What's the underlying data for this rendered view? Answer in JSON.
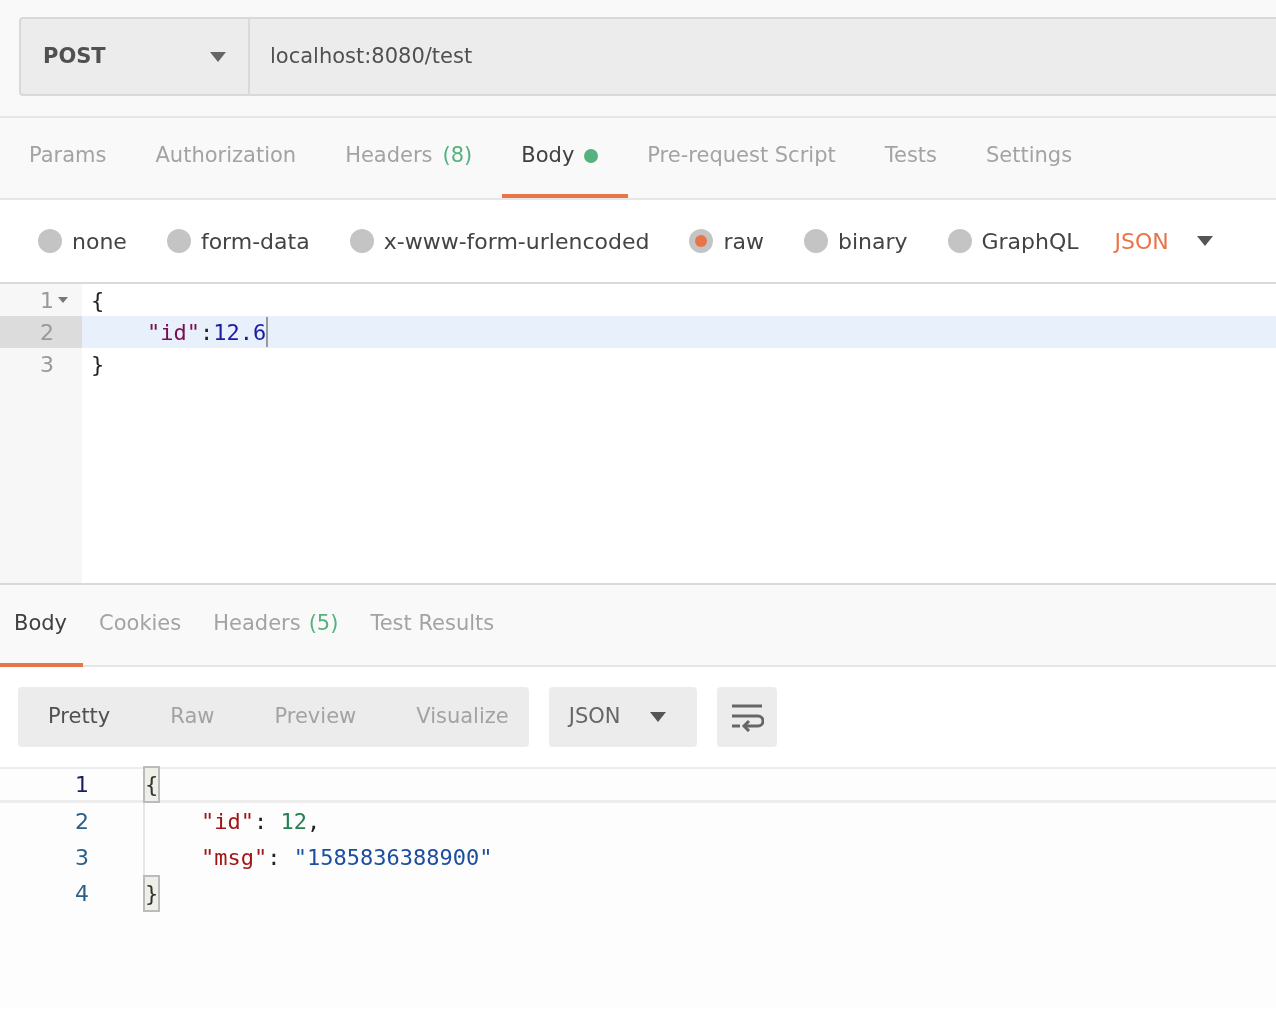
{
  "request": {
    "method": "POST",
    "url": "localhost:8080/test"
  },
  "request_tabs": [
    {
      "label": "Params",
      "selected": false
    },
    {
      "label": "Authorization",
      "selected": false
    },
    {
      "label": "Headers",
      "count": "(8)",
      "selected": false
    },
    {
      "label": "Body",
      "selected": true,
      "has_changes": true
    },
    {
      "label": "Pre-request Script",
      "selected": false
    },
    {
      "label": "Tests",
      "selected": false
    },
    {
      "label": "Settings",
      "selected": false
    }
  ],
  "body_types": [
    {
      "label": "none",
      "selected": false
    },
    {
      "label": "form-data",
      "selected": false
    },
    {
      "label": "x-www-form-urlencoded",
      "selected": false
    },
    {
      "label": "raw",
      "selected": true
    },
    {
      "label": "binary",
      "selected": false
    },
    {
      "label": "GraphQL",
      "selected": false
    }
  ],
  "body_format": "JSON",
  "request_editor": {
    "lines": [
      {
        "number": "1",
        "foldable": true,
        "selected": false,
        "tokens": [
          {
            "kind": "punct",
            "text": "{"
          }
        ]
      },
      {
        "number": "2",
        "foldable": false,
        "selected": true,
        "tokens": [
          {
            "kind": "key",
            "text": "\"id\""
          },
          {
            "kind": "punct",
            "text": ":"
          },
          {
            "kind": "number",
            "text": "12.6"
          }
        ]
      },
      {
        "number": "3",
        "foldable": false,
        "selected": false,
        "tokens": [
          {
            "kind": "punct",
            "text": "}"
          }
        ]
      }
    ]
  },
  "response_tabs": [
    {
      "label": "Body",
      "selected": true
    },
    {
      "label": "Cookies",
      "selected": false
    },
    {
      "label": "Headers",
      "count": "(5)",
      "selected": false
    },
    {
      "label": "Test Results",
      "selected": false
    }
  ],
  "view_modes": [
    {
      "label": "Pretty",
      "selected": true
    },
    {
      "label": "Raw",
      "selected": false
    },
    {
      "label": "Preview",
      "selected": false
    },
    {
      "label": "Visualize",
      "selected": false
    }
  ],
  "response_format": "JSON",
  "response_editor": {
    "lines": [
      {
        "number": "1",
        "tokens": [
          {
            "kind": "bracket-matched",
            "text": "{"
          }
        ]
      },
      {
        "number": "2",
        "tokens": [
          {
            "kind": "key",
            "text": "\"id\""
          },
          {
            "kind": "punct",
            "text": ": "
          },
          {
            "kind": "number",
            "text": "12"
          },
          {
            "kind": "punct",
            "text": ","
          }
        ]
      },
      {
        "number": "3",
        "tokens": [
          {
            "kind": "key",
            "text": "\"msg\""
          },
          {
            "kind": "punct",
            "text": ": "
          },
          {
            "kind": "string",
            "text": "\"1585836388900\""
          }
        ]
      },
      {
        "number": "4",
        "tokens": [
          {
            "kind": "bracket-matched",
            "text": "}"
          }
        ]
      }
    ]
  }
}
